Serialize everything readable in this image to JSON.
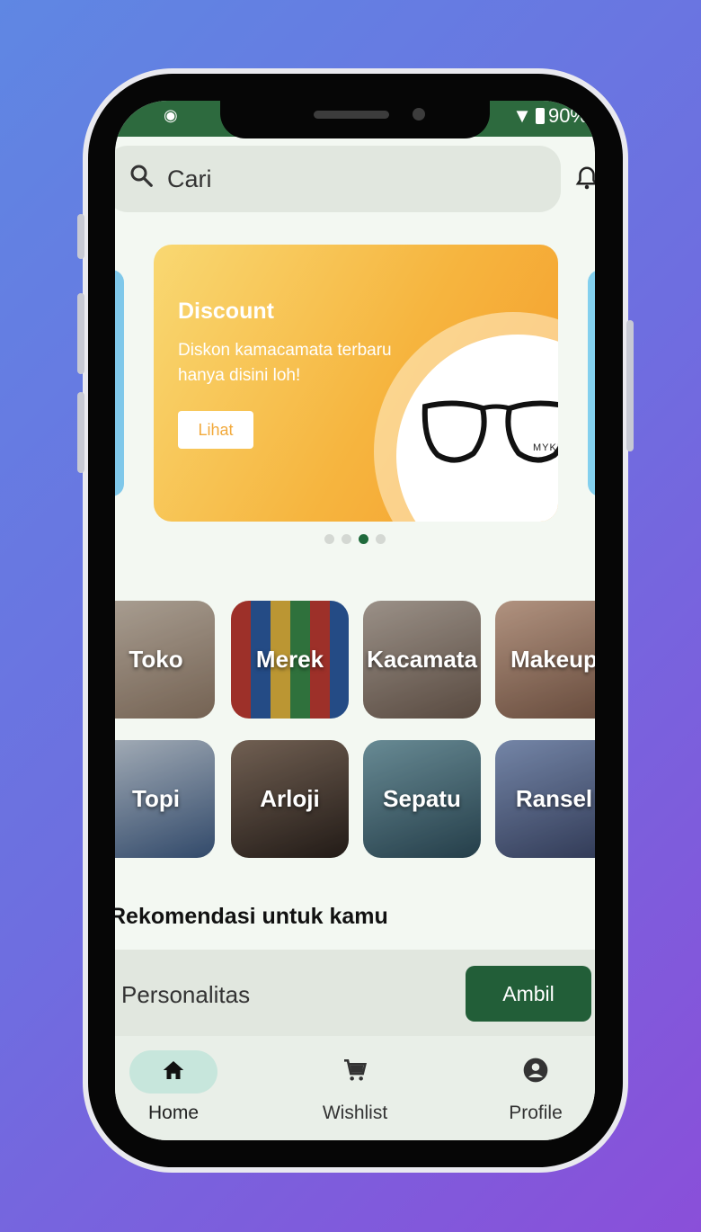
{
  "status_bar": {
    "battery": "90%"
  },
  "search": {
    "placeholder": "Cari"
  },
  "banner": {
    "title": "Discount",
    "subtitle": "Diskon kamacamata terbaru hanya disini loh!",
    "button_label": "Lihat",
    "brand_text": "MYKI",
    "carousel_pages": 4,
    "carousel_active_index": 2
  },
  "categories": [
    {
      "label": "Toko",
      "icon": "store-photo",
      "color": "#b19a82"
    },
    {
      "label": "Merek",
      "icon": "brands-photo",
      "color": "#c45842"
    },
    {
      "label": "Kacamata",
      "icon": "glasses-photo",
      "color": "#8c7a6c"
    },
    {
      "label": "Makeup",
      "icon": "makeup-photo",
      "color": "#b98b72"
    },
    {
      "label": "Topi",
      "icon": "cap-photo",
      "color": "#5f7fa5"
    },
    {
      "label": "Arloji",
      "icon": "watch-photo",
      "color": "#5a4b42"
    },
    {
      "label": "Sepatu",
      "icon": "shoe-photo",
      "color": "#4a7a8c"
    },
    {
      "label": "Ransel",
      "icon": "bag-photo",
      "color": "#5a6f9a"
    }
  ],
  "recommendation": {
    "title": "Rekomendasi untuk kamu"
  },
  "promo": {
    "label": "Personalitas",
    "button_label": "Ambil"
  },
  "bottom_nav": [
    {
      "label": "Home",
      "icon": "home-icon",
      "active": true
    },
    {
      "label": "Wishlist",
      "icon": "cart-icon",
      "active": false
    },
    {
      "label": "Profile",
      "icon": "account-icon",
      "active": false
    }
  ],
  "colors": {
    "primary": "#225e38",
    "background": "#f3f8f2",
    "banner_gradient_start": "#f9d872",
    "banner_gradient_end": "#f49c2b"
  }
}
